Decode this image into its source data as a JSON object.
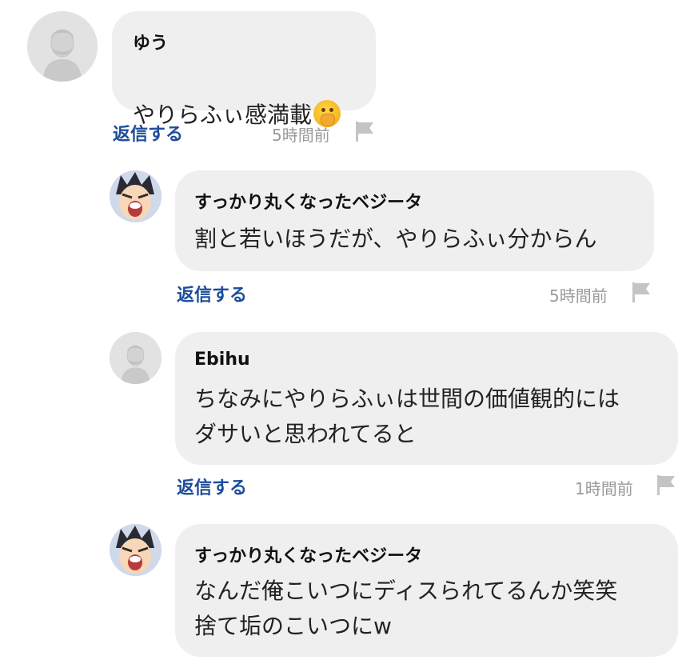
{
  "comments": [
    {
      "author": "ゆう",
      "text": "やりらふぃ感満載",
      "emoji_icon": "face-with-hand-over-mouth-icon",
      "reply_label": "返信する",
      "time": "5時間前",
      "avatar": "default-avatar-icon"
    },
    {
      "author": "すっかり丸くなったベジータ",
      "text": "割と若いほうだが、やりらふぃ分からん",
      "reply_label": "返信する",
      "time": "5時間前",
      "avatar": "vegeta-avatar-icon"
    },
    {
      "author": "Ebihu",
      "text": "ちなみにやりらふぃは世間の価値観的には\nダサいと思われてると",
      "reply_label": "返信する",
      "time": "1時間前",
      "avatar": "default-avatar-icon"
    },
    {
      "author": "すっかり丸くなったベジータ",
      "text": "なんだ俺こいつにディスられてるんか笑笑\n捨て垢のこいつにw",
      "avatar": "vegeta-avatar-icon"
    }
  ],
  "colors": {
    "bubble": "#efefef",
    "reply": "#1d4c9c",
    "time": "#9a9a9a",
    "flag": "#c4c4c4"
  }
}
